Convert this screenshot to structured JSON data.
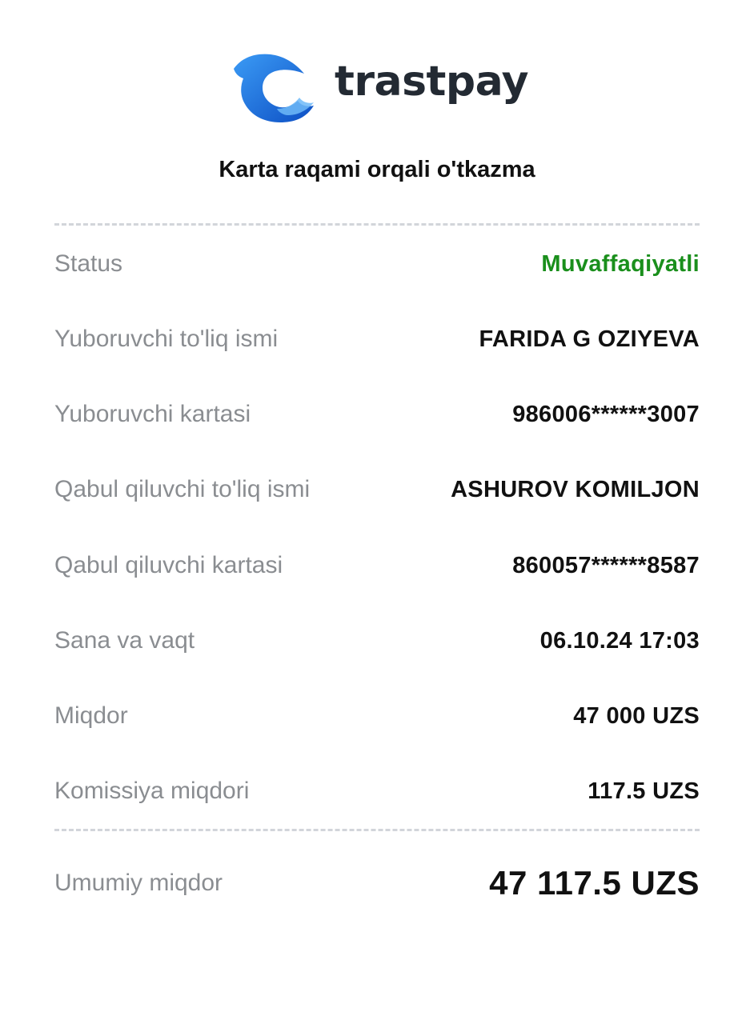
{
  "brand": {
    "name": "trastpay",
    "logo_icon": "dolphin-logo-icon",
    "colors": {
      "logo_blue": "#1565d8",
      "logo_light_blue": "#3b9bf5",
      "text_dark": "#232a33"
    }
  },
  "receipt": {
    "title": "Karta raqami orqali o'tkazma",
    "status_color": "#1a8f1c",
    "rows": [
      {
        "label": "Status",
        "value": "Muvaffaqiyatli"
      },
      {
        "label": "Yuboruvchi to'liq ismi",
        "value": "FARIDA G OZIYEVA"
      },
      {
        "label": "Yuboruvchi kartasi",
        "value": "986006******3007"
      },
      {
        "label": "Qabul qiluvchi to'liq ismi",
        "value": "ASHUROV KOMILJON"
      },
      {
        "label": "Qabul qiluvchi kartasi",
        "value": "860057******8587"
      },
      {
        "label": "Sana va vaqt",
        "value": "06.10.24 17:03"
      },
      {
        "label": "Miqdor",
        "value": "47 000 UZS"
      },
      {
        "label": "Komissiya miqdori",
        "value": "117.5 UZS"
      }
    ],
    "total": {
      "label": "Umumiy miqdor",
      "value": "47 117.5 UZS"
    }
  }
}
